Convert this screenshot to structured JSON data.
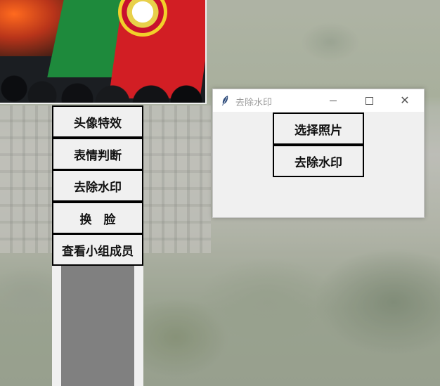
{
  "menu": {
    "items": [
      {
        "label": "头像特效"
      },
      {
        "label": "表情判断"
      },
      {
        "label": "去除水印"
      },
      {
        "label": "换　脸"
      },
      {
        "label": "查看小组成员"
      }
    ]
  },
  "dialog": {
    "title": "去除水印",
    "buttons": {
      "select_photo": "选择照片",
      "remove_watermark": "去除水印"
    }
  },
  "icons": {
    "app": "feather-icon",
    "minimize": "minimize-icon",
    "maximize": "maximize-icon",
    "close": "close-icon"
  }
}
